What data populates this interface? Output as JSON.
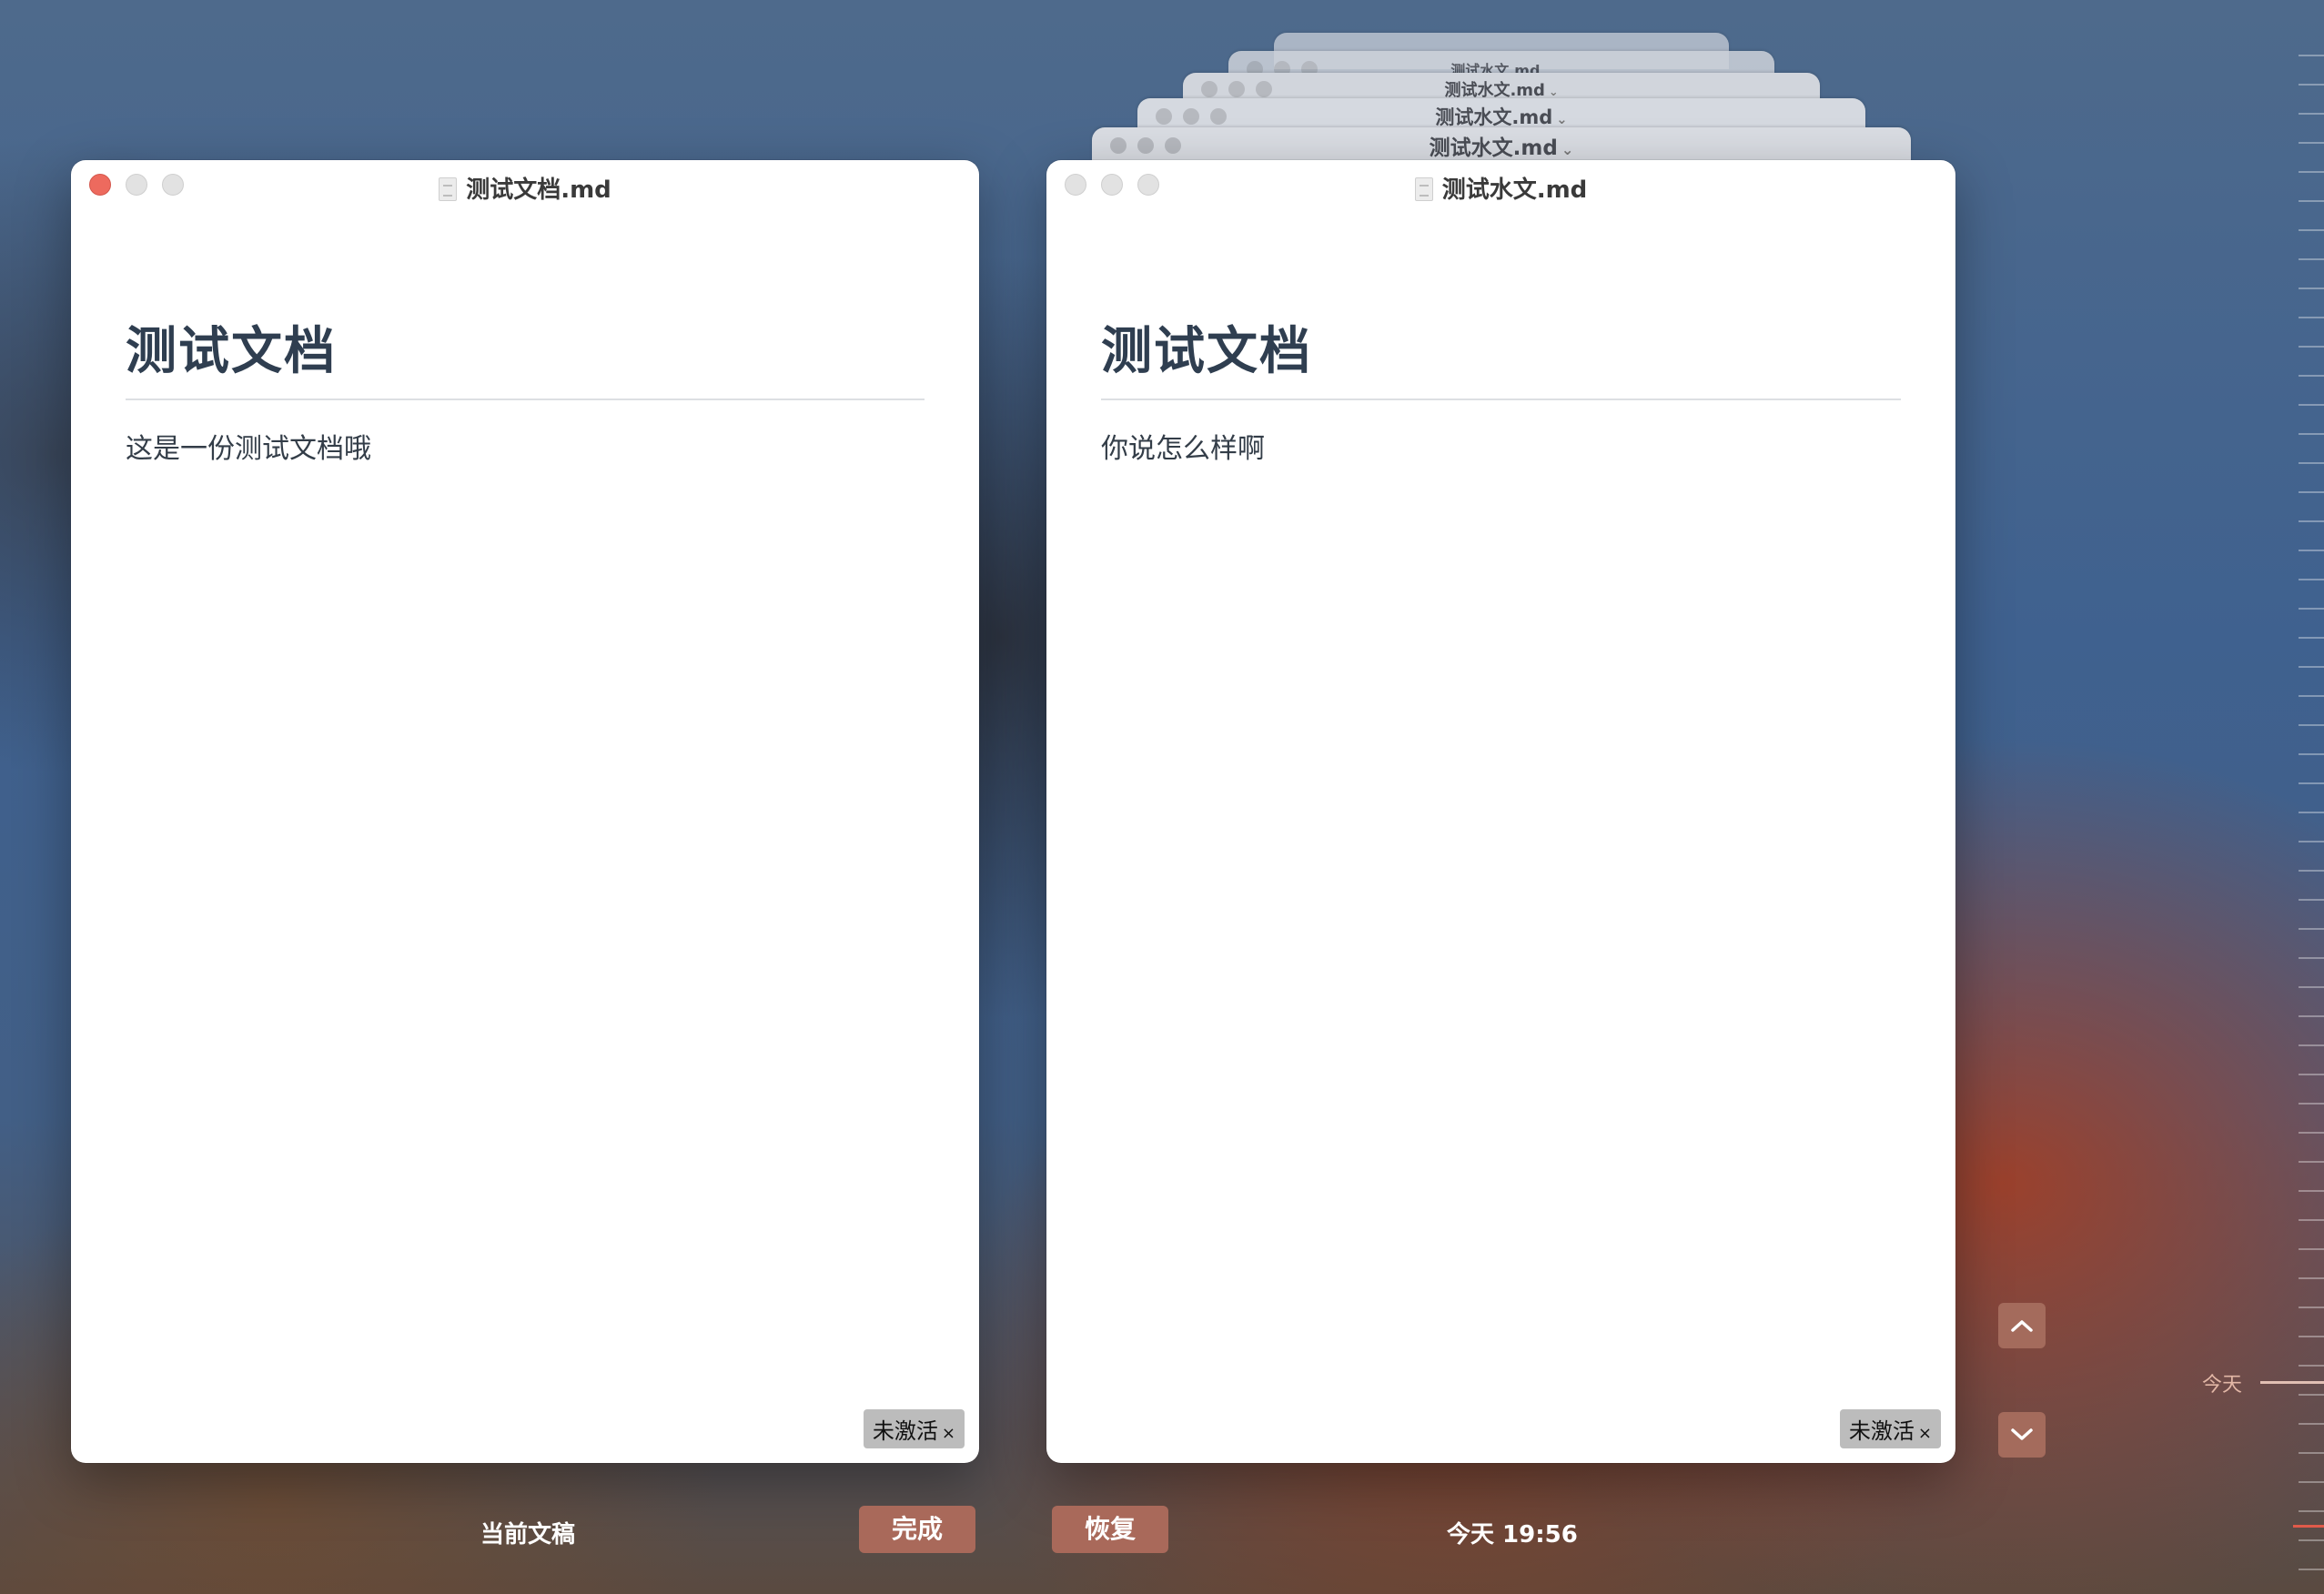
{
  "stacked_windows": [
    {
      "title": "测试水文.md"
    },
    {
      "title": "测试水文.md"
    },
    {
      "title": "测试水文.md"
    },
    {
      "title": "测试水文.md"
    }
  ],
  "left_window": {
    "title": "测试文档.md",
    "heading": "测试文档",
    "paragraph": "这是一份测试文档哦",
    "badge": "未激活",
    "badge_close": "×"
  },
  "right_window": {
    "title": "测试水文.md",
    "heading": "测试文档",
    "paragraph": "你说怎么样啊",
    "badge": "未激活",
    "badge_close": "×"
  },
  "bottom_bar": {
    "current_label": "当前文稿",
    "done_button": "完成",
    "restore_button": "恢复",
    "timestamp": "今天 19:56"
  },
  "timeline": {
    "today_label": "今天"
  },
  "icons": {
    "nav_up": "chevron-up-icon",
    "nav_down": "chevron-down-icon",
    "file": "document-icon"
  },
  "colors": {
    "button": "#a9695a",
    "close_red": "#ed6a5e",
    "timeline_current": "#e05a4a"
  }
}
